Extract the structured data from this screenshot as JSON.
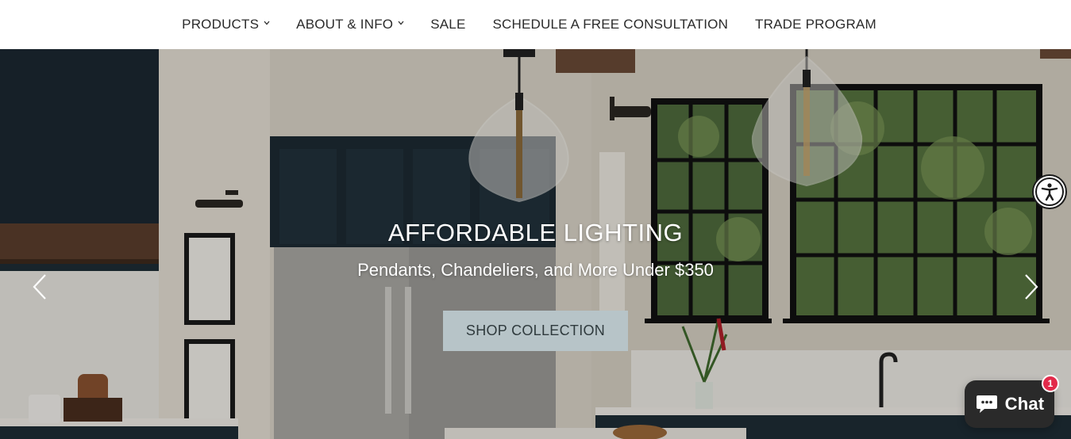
{
  "nav": {
    "items": [
      {
        "label": "PRODUCTS",
        "has_dropdown": true
      },
      {
        "label": "ABOUT & INFO",
        "has_dropdown": true
      },
      {
        "label": "SALE",
        "has_dropdown": false
      },
      {
        "label": "SCHEDULE A FREE CONSULTATION",
        "has_dropdown": false
      },
      {
        "label": "TRADE PROGRAM",
        "has_dropdown": false
      }
    ]
  },
  "hero": {
    "title": "AFFORDABLE LIGHTING",
    "subtitle": "Pendants, Chandeliers, and More Under $350",
    "cta_label": "SHOP COLLECTION",
    "prev_icon": "chevron-left-icon",
    "next_icon": "chevron-right-icon"
  },
  "accessibility": {
    "icon": "accessibility-icon"
  },
  "chat": {
    "label": "Chat",
    "badge_count": "1",
    "icon": "chat-bubble-icon"
  },
  "colors": {
    "nav_text": "#2b2b2b",
    "cta_bg": "#b7c4c8",
    "cta_text": "#2f3a3d",
    "chat_bg": "#2a2a2a",
    "badge_bg": "#e22a4a"
  }
}
